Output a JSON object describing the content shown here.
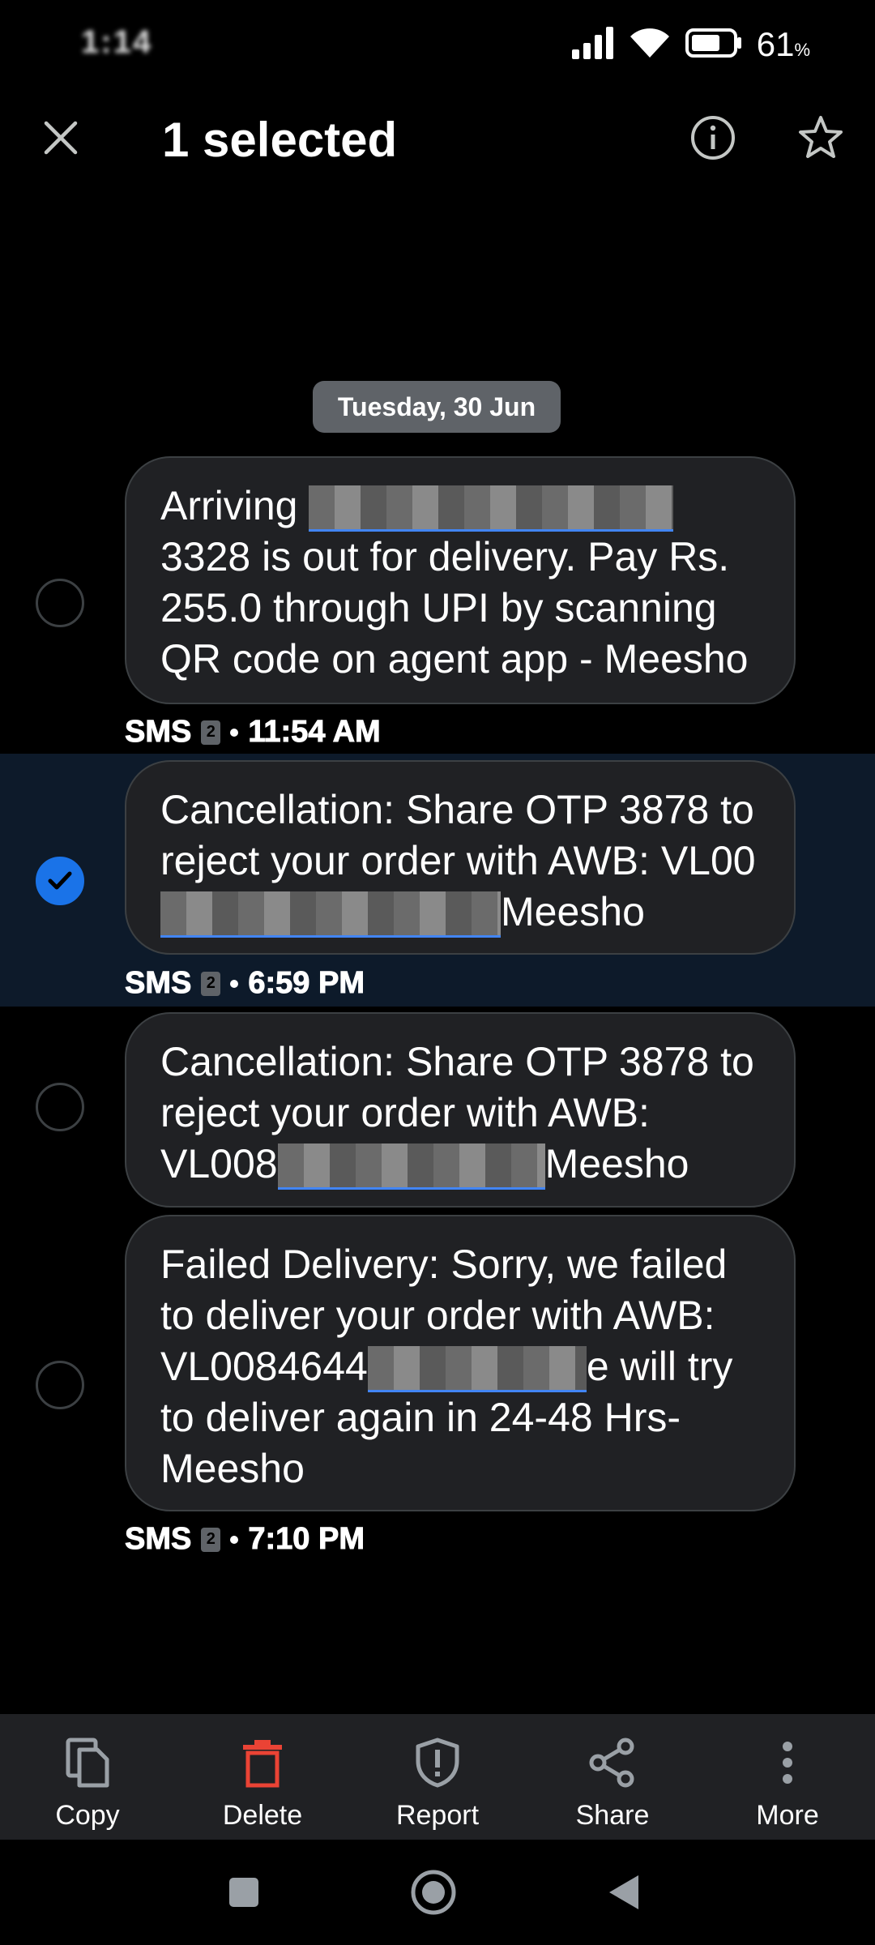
{
  "status_bar": {
    "time": "1:14",
    "battery": "61",
    "battery_unit": "%",
    "icons": [
      "signal-icon",
      "wifi-icon",
      "battery-icon"
    ]
  },
  "app_bar": {
    "title": "1 selected",
    "icons": [
      "close-icon",
      "info-icon",
      "star-icon"
    ]
  },
  "date_chip": "Tuesday, 30 Jun",
  "messages": [
    {
      "line1_pre": "Arriving ",
      "line1_post": "3328 is",
      "rest": "out for delivery. Pay Rs. 255.0 through UPI by scanning QR code on agent app - Meesho",
      "selected": false
    },
    {
      "line1": "Cancellation: Share OTP 3878 to reject your order with AWB:",
      "prefix": "VL00",
      "suffix": "Meesho",
      "selected": true
    },
    {
      "line1": "Cancellation: Share OTP 3878 to reject your order with AWB:",
      "prefix": "VL008",
      "suffix": "Meesho",
      "selected": false
    },
    {
      "line1": "Failed Delivery: Sorry, we failed to deliver your order with AWB:",
      "prefix": "VL0084644",
      "suffix": "e will try",
      "rest": "to deliver again in 24-48 Hrs- Meesho",
      "selected": false
    }
  ],
  "meta": [
    {
      "type": "SMS",
      "sim": "2",
      "time": "11:54 AM"
    },
    {
      "type": "SMS",
      "sim": "2",
      "time": "6:59 PM"
    },
    {
      "type": "SMS",
      "sim": "2",
      "time": "7:10 PM"
    }
  ],
  "actions": [
    {
      "label": "Copy",
      "icon": "copy-icon",
      "color": "#9aa0a6"
    },
    {
      "label": "Delete",
      "icon": "delete-icon",
      "color": "#ea4335"
    },
    {
      "label": "Report",
      "icon": "report-shield-icon",
      "color": "#9aa0a6"
    },
    {
      "label": "Share",
      "icon": "share-icon",
      "color": "#9aa0a6"
    },
    {
      "label": "More",
      "icon": "more-vert-icon",
      "color": "#9aa0a6"
    }
  ],
  "nav": [
    "recents-icon",
    "home-icon",
    "back-icon"
  ],
  "colors": {
    "background": "#000000",
    "bubble": "#202124",
    "selected_row": "#0d1a2a",
    "accent": "#1a73e8",
    "delete": "#ea4335"
  }
}
